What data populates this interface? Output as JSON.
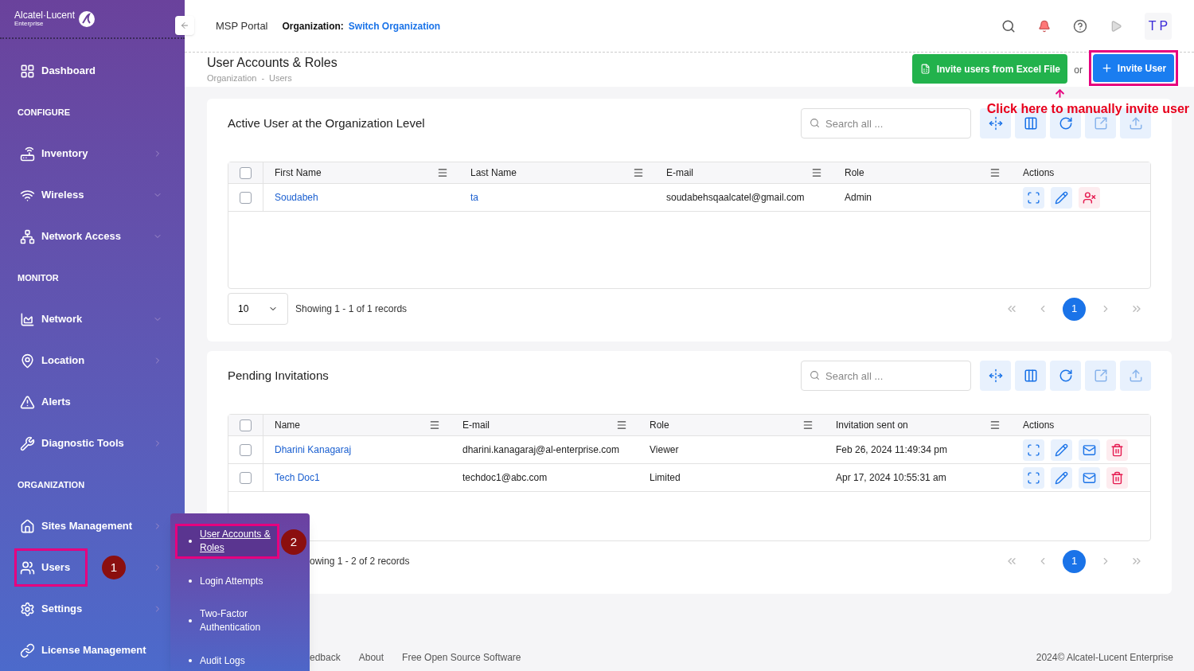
{
  "sidebar": {
    "brand": "Alcatel·Lucent",
    "brand_sub": "Enterprise",
    "items": [
      {
        "kind": "link",
        "label": "Dashboard"
      },
      {
        "kind": "heading",
        "label": "CONFIGURE"
      },
      {
        "kind": "flyout",
        "label": "Inventory"
      },
      {
        "kind": "group",
        "label": "Wireless"
      },
      {
        "kind": "group",
        "label": "Network Access"
      },
      {
        "kind": "heading",
        "label": "MONITOR"
      },
      {
        "kind": "group",
        "label": "Network"
      },
      {
        "kind": "flyout",
        "label": "Location"
      },
      {
        "kind": "link",
        "label": "Alerts"
      },
      {
        "kind": "flyout",
        "label": "Diagnostic Tools"
      },
      {
        "kind": "heading",
        "label": "ORGANIZATION"
      },
      {
        "kind": "flyout",
        "label": "Sites Management"
      },
      {
        "kind": "flyout",
        "label": "Users",
        "callout": "1"
      },
      {
        "kind": "flyout",
        "label": "Settings"
      },
      {
        "kind": "link",
        "label": "License Management"
      }
    ]
  },
  "flyout": {
    "callout": "2",
    "items": [
      {
        "label": "User Accounts & Roles",
        "selected": true
      },
      {
        "label": "Login Attempts",
        "selected": false
      },
      {
        "label": "Two-Factor Authentication",
        "selected": false
      },
      {
        "label": "Audit Logs",
        "selected": false
      }
    ]
  },
  "header": {
    "portal": "MSP Portal",
    "org_label": "Organization:",
    "org_link": "Switch Organization",
    "avatar": "T P"
  },
  "page": {
    "title": "User Accounts & Roles",
    "breadcrumb": [
      "Organization",
      "Users"
    ],
    "breadcrumb_sep": "-",
    "excel_button": "Invite users from Excel File",
    "or": "or",
    "invite_button": "Invite User",
    "callout_text": "Click here to manually invite user"
  },
  "cards": [
    {
      "title": "Active User at the Organization Level",
      "search_placeholder": "Search all ...",
      "all_checked": false,
      "columns": [
        "First Name",
        "Last Name",
        "E-mail",
        "Role",
        "Actions"
      ],
      "actions": [
        {
          "kind": "expand"
        },
        {
          "kind": "edit"
        },
        {
          "kind": "remove-user"
        }
      ],
      "rows": [
        {
          "checked": false,
          "cells": [
            {
              "text": "Soudabeh",
              "link": true
            },
            {
              "text": "ta",
              "link": true
            },
            {
              "text": "soudabehsqaalcatel@gmail.com",
              "link": false
            },
            {
              "text": "Admin",
              "link": false
            }
          ]
        }
      ],
      "page_size": "10",
      "showing": "Showing 1 - 1 of 1 records",
      "pages": [
        {
          "label": "1",
          "selected": true
        }
      ]
    },
    {
      "title": "Pending Invitations",
      "search_placeholder": "Search all ...",
      "all_checked": false,
      "columns": [
        "Name",
        "E-mail",
        "Role",
        "Invitation sent on",
        "Actions"
      ],
      "actions": [
        {
          "kind": "expand"
        },
        {
          "kind": "edit"
        },
        {
          "kind": "mail"
        },
        {
          "kind": "delete"
        }
      ],
      "rows": [
        {
          "checked": false,
          "cells": [
            {
              "text": "Dharini Kanagaraj",
              "link": true
            },
            {
              "text": "dharini.kanagaraj@al-enterprise.com",
              "link": false
            },
            {
              "text": "Viewer",
              "link": false
            },
            {
              "text": "Feb 26, 2024 11:49:34 pm",
              "link": false
            }
          ]
        },
        {
          "checked": false,
          "cells": [
            {
              "text": "Tech Doc1",
              "link": true
            },
            {
              "text": "techdoc1@abc.com",
              "link": false
            },
            {
              "text": "Limited",
              "link": false
            },
            {
              "text": "Apr 17, 2024 10:55:31 am",
              "link": false
            }
          ]
        }
      ],
      "showing": "owing 1 - 2 of 2 records",
      "pages": [
        {
          "label": "1",
          "selected": true
        }
      ]
    }
  ],
  "footer": {
    "links": [
      "edback",
      "About",
      "Free Open Source Software"
    ],
    "copyright": "2024© Alcatel-Lucent Enterprise"
  }
}
